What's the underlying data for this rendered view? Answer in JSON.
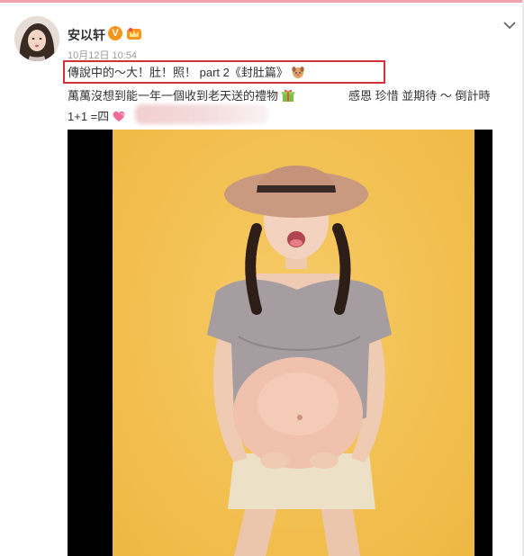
{
  "post": {
    "user_name": "安以轩",
    "verified_badge": "V",
    "timestamp": "10月12日 10:54",
    "line1": "傳說中的～大！肚！照！ part 2《封肚篇》",
    "line2_left": "萬萬沒想到能一年一個收到老天送的禮物",
    "line2_right": "感恩  珍惜  並期待 ～ 倒計時",
    "line3": "1+1 =四"
  },
  "icons": {
    "menu": "chevron-down-icon",
    "member": "member-crown-icon",
    "line1_emoji": "puppy-emoji-icon",
    "line2_emoji": "gift-emoji-icon",
    "line3_emoji": "heart-emoji-icon"
  },
  "colors": {
    "highlight_border": "#d3313a",
    "verified_badge": "#f7941d",
    "photo_background": "#f2c050",
    "photo_letterbox": "#000000",
    "top_strip": "#f2a3ad"
  }
}
